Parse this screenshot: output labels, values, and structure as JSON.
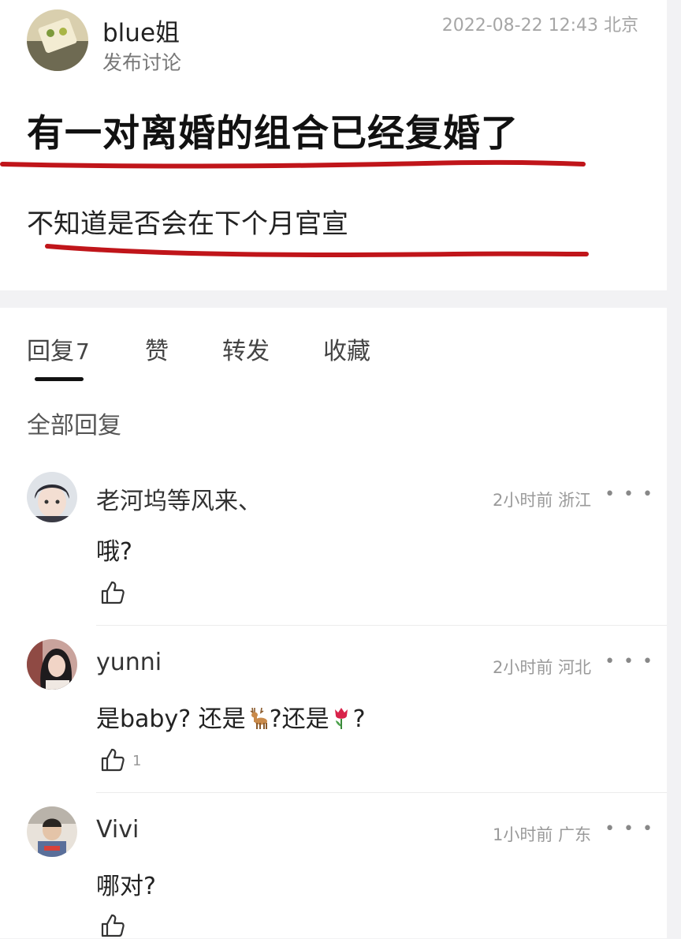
{
  "post": {
    "author": "blue姐",
    "subtitle": "发布讨论",
    "timestamp": "2022-08-22 12:43 北京",
    "title": "有一对离婚的组合已经复婚了",
    "body": "不知道是否会在下个月官宣"
  },
  "tabs": {
    "reply_label": "回复",
    "reply_count": "7",
    "like_label": "赞",
    "share_label": "转发",
    "favorite_label": "收藏"
  },
  "section_title": "全部回复",
  "comments": [
    {
      "name": "老河坞等风来、",
      "meta": "2小时前 浙江",
      "text": "哦?",
      "likes": ""
    },
    {
      "name": "yunni",
      "meta": "2小时前 河北",
      "text_parts": [
        "是baby? 还是",
        "?还是",
        "?"
      ],
      "likes": "1"
    },
    {
      "name": "Vivi",
      "meta": "1小时前 广东",
      "text": "哪对?",
      "likes": ""
    }
  ],
  "more_glyph": "• • •",
  "icons": {
    "emoji_1": "deer-emoji-icon",
    "emoji_2": "tulip-emoji-icon",
    "like": "thumbs-up-icon",
    "more": "more-dots-icon"
  },
  "colors": {
    "underline": "#c0151a",
    "background": "#f2f2f4"
  }
}
